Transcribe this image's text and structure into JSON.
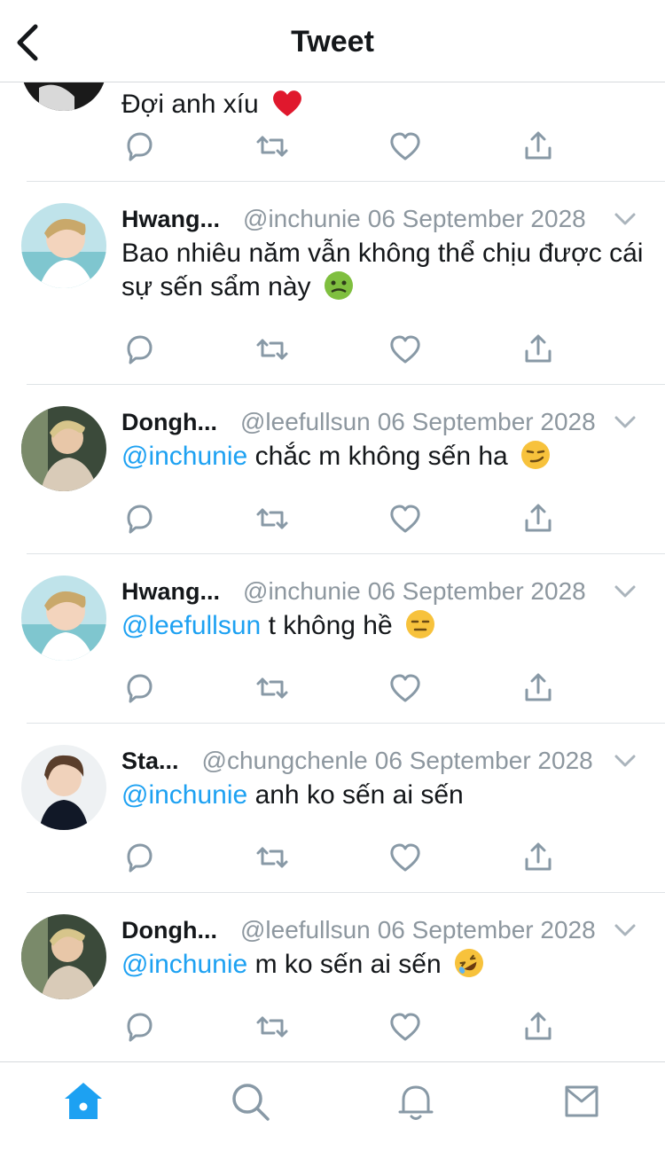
{
  "header": {
    "title": "Tweet",
    "back_icon": "chevron-left-icon"
  },
  "partial_tweet": {
    "text": "Đợi anh xíu",
    "emoji": "red-heart"
  },
  "tweets": [
    {
      "name": "Hwang...",
      "handle": "@inchunie",
      "date": "06 September 2028",
      "mention": "",
      "text": "Bao nhiêu năm vẫn không thể chịu được cái sự sến sẩm này",
      "emoji": "nauseated-face"
    },
    {
      "name": "Dongh...",
      "handle": "@leefullsun",
      "date": "06 September 2028",
      "mention": "@inchunie",
      "text": "chắc m không sến ha",
      "emoji": "smirking-face"
    },
    {
      "name": "Hwang...",
      "handle": "@inchunie",
      "date": "06 September 2028",
      "mention": "@leefullsun",
      "text": "t không hề",
      "emoji": "expressionless-face"
    },
    {
      "name": "Sta...",
      "handle": "@chungchenle",
      "date": "06 September 2028",
      "mention": "@inchunie",
      "text": "anh ko sến ai sến",
      "emoji": ""
    },
    {
      "name": "Dongh...",
      "handle": "@leefullsun",
      "date": "06 September 2028",
      "mention": "@inchunie",
      "text": "m ko sến ai sến",
      "emoji": "rolling-on-floor-laughing"
    }
  ],
  "actions": [
    "reply-icon",
    "retweet-icon",
    "like-icon",
    "share-icon"
  ],
  "bottom_nav": [
    "home-icon",
    "search-icon",
    "notifications-icon",
    "messages-icon"
  ],
  "colors": {
    "accent": "#1da1f2",
    "muted": "#8d979f",
    "icon": "#8899a6",
    "text": "#14171a"
  }
}
